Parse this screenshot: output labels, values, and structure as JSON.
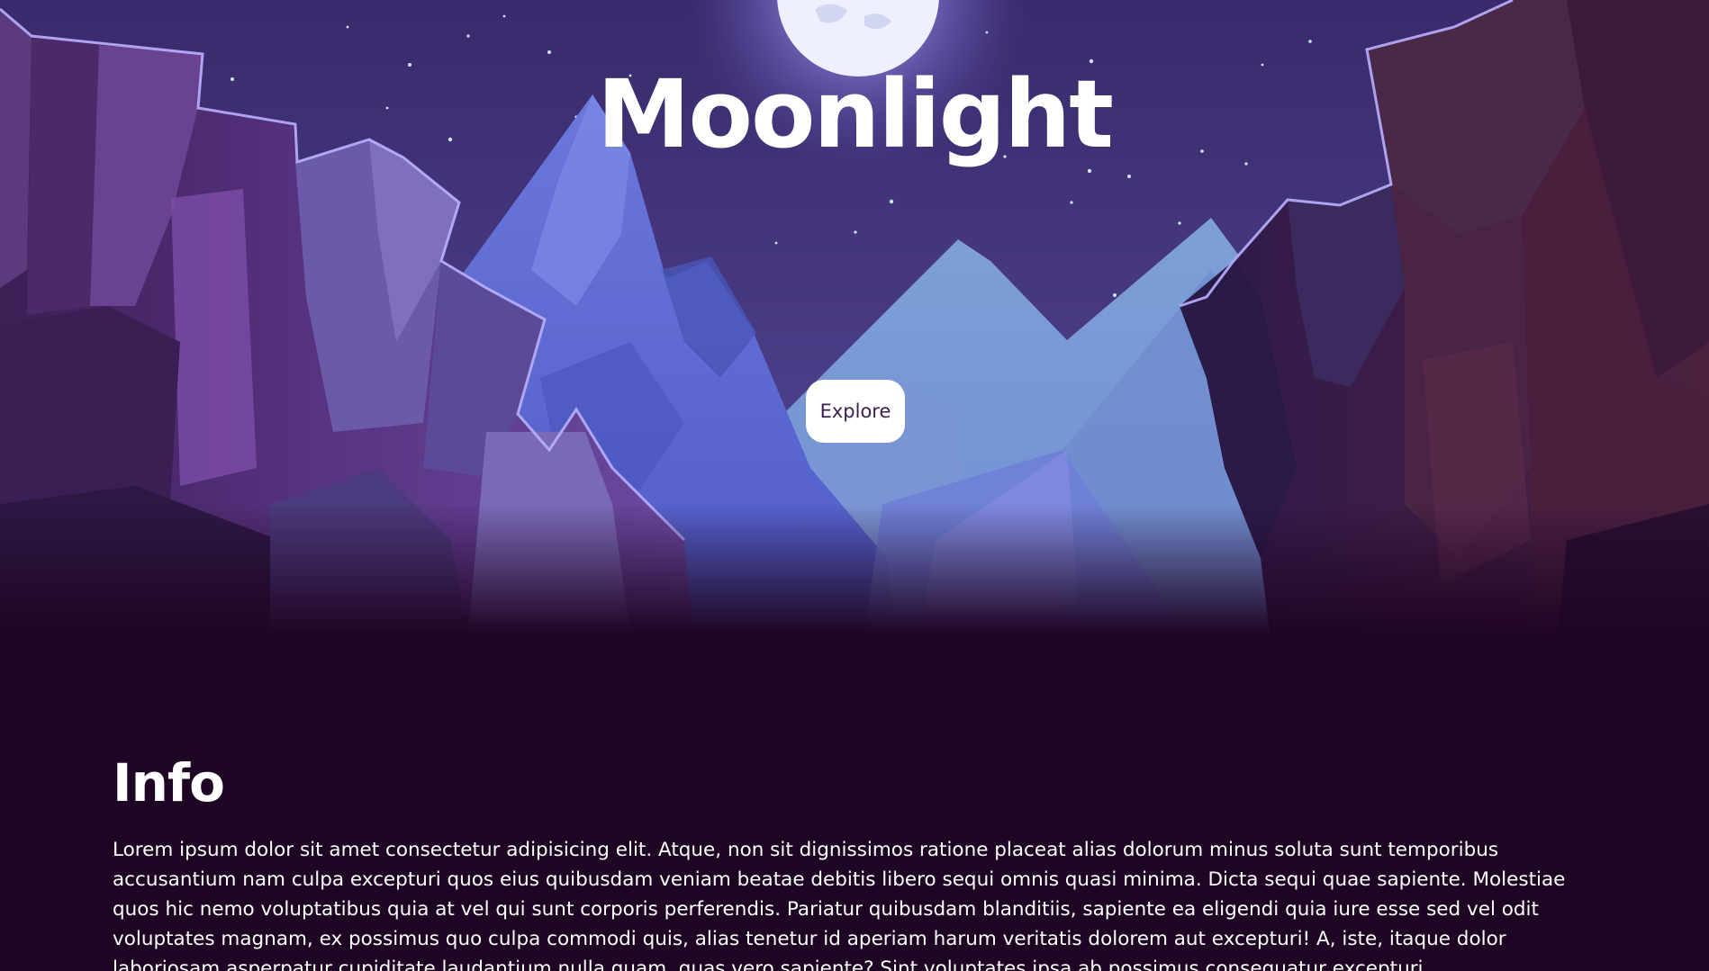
{
  "hero": {
    "title": "Moonlight",
    "explore_label": "Explore",
    "scene_icon": "night-mountain-canyon-illustration"
  },
  "info": {
    "heading": "Info",
    "body": "Lorem ipsum dolor sit amet consectetur adipisicing elit. Atque, non sit dignissimos ratione placeat alias dolorum minus soluta sunt temporibus accusantium nam culpa excepturi quos eius quibusdam veniam beatae debitis libero sequi omnis quasi minima. Dicta sequi quae sapiente. Molestiae quos hic nemo voluptatibus quia at vel qui sunt corporis perferendis. Pariatur quibusdam blanditiis, sapiente ea eligendi quia iure esse sed vel odit voluptates magnam, ex possimus quo culpa commodi quis, alias tenetur id aperiam harum veritatis dolorem aut excepturi! A, iste, itaque dolor laboriosam asperpatur cupiditate laudantium nulla quam, quas vero sapiente? Sint voluptates ipsa ab possimus consequatur excepturi."
  },
  "colors": {
    "page_background": "#1f0524",
    "sky": "#3e2d70",
    "mountain_blue": "#5d6fd6",
    "far_mountain": "#7ea3d8",
    "cliff_purple": "#4a2a6e",
    "cliff_dark": "#2a1236",
    "cliff_right_maroon": "#3f1c3c",
    "button_background": "#ffffff",
    "button_text": "#3a2150",
    "text": "#ffffff"
  }
}
